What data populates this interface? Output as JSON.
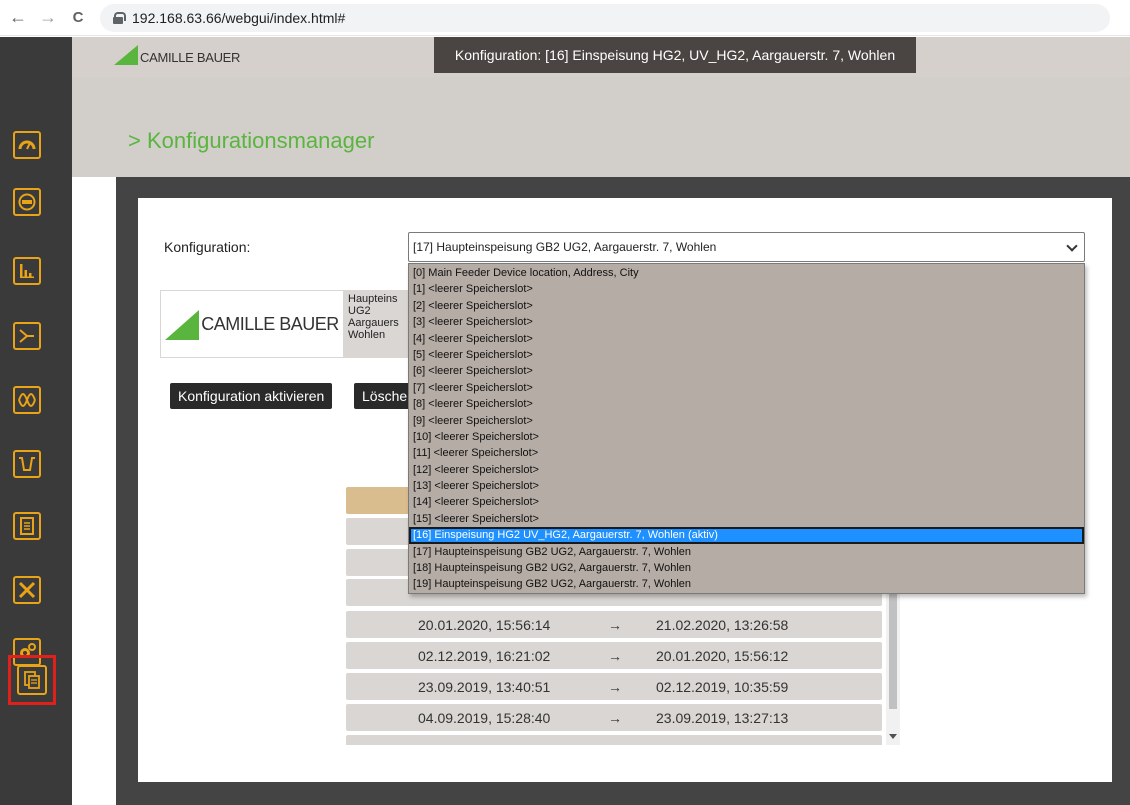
{
  "browser": {
    "back": "←",
    "forward": "→",
    "reload": "C",
    "url": "192.168.63.66/webgui/index.html#"
  },
  "header": {
    "logo_text": "CAMILLE BAUER",
    "title": "Konfiguration: [16] Einspeisung HG2, UV_HG2, Aargauerstr. 7, Wohlen"
  },
  "page": {
    "title": "> Konfigurationsmanager",
    "config_label": "Konfiguration:",
    "selected_value": "[17] Haupteinspeisung GB2 UG2, Aargauerstr. 7, Wohlen"
  },
  "info": {
    "logo_text": "CAMILLE BAUER",
    "lines": [
      "Haupteins",
      "UG2",
      "Aargauers",
      "Wohlen"
    ]
  },
  "buttons": {
    "activate": "Konfiguration aktivieren",
    "delete": "Lösche"
  },
  "dropdown_options": [
    "[0] Main Feeder Device location, Address, City",
    "[1] <leerer Speicherslot>",
    "[2] <leerer Speicherslot>",
    "[3] <leerer Speicherslot>",
    "[4] <leerer Speicherslot>",
    "[5] <leerer Speicherslot>",
    "[6] <leerer Speicherslot>",
    "[7] <leerer Speicherslot>",
    "[8] <leerer Speicherslot>",
    "[9] <leerer Speicherslot>",
    "[10] <leerer Speicherslot>",
    "[11] <leerer Speicherslot>",
    "[12] <leerer Speicherslot>",
    "[13] <leerer Speicherslot>",
    "[14] <leerer Speicherslot>",
    "[15] <leerer Speicherslot>",
    "[16] Einspeisung HG2 UV_HG2, Aargauerstr. 7, Wohlen (aktiv)",
    "[17] Haupteinspeisung GB2 UG2, Aargauerstr. 7, Wohlen",
    "[18] Haupteinspeisung GB2 UG2, Aargauerstr. 7, Wohlen",
    "[19] Haupteinspeisung GB2 UG2, Aargauerstr. 7, Wohlen"
  ],
  "history": {
    "arrow": "→",
    "rows": [
      {
        "from": "20.01.2020, 15:56:14",
        "to": "21.02.2020, 13:26:58"
      },
      {
        "from": "02.12.2019, 16:21:02",
        "to": "20.01.2020, 15:56:12"
      },
      {
        "from": "23.09.2019, 13:40:51",
        "to": "02.12.2019, 10:35:59"
      },
      {
        "from": "04.09.2019, 15:28:40",
        "to": "23.09.2019, 13:27:13"
      }
    ]
  }
}
